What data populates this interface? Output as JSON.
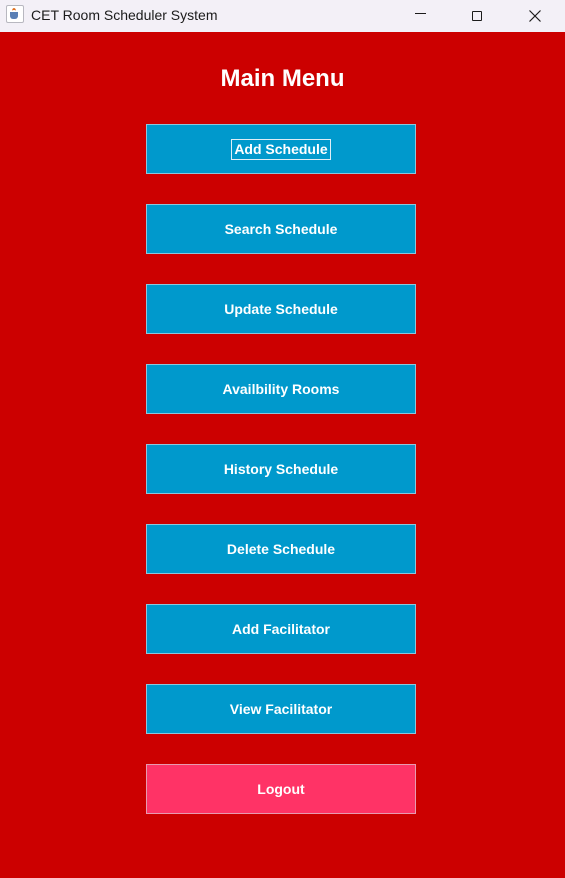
{
  "window": {
    "title": "CET Room Scheduler System",
    "icon": "java-cup-icon",
    "controls": [
      "minimize-icon",
      "maximize-icon",
      "close-icon"
    ]
  },
  "main": {
    "heading": "Main Menu",
    "buttons": [
      {
        "label": "Add Schedule",
        "focused": true
      },
      {
        "label": "Search Schedule"
      },
      {
        "label": "Update Schedule"
      },
      {
        "label": "Availbility Rooms"
      },
      {
        "label": "History Schedule"
      },
      {
        "label": "Delete Schedule"
      },
      {
        "label": "Add Facilitator"
      },
      {
        "label": "View Facilitator"
      }
    ],
    "logout": {
      "label": "Logout"
    }
  },
  "colors": {
    "background": "#cc0000",
    "button": "#0099cc",
    "logout": "#ff3366",
    "text": "#ffffff"
  }
}
